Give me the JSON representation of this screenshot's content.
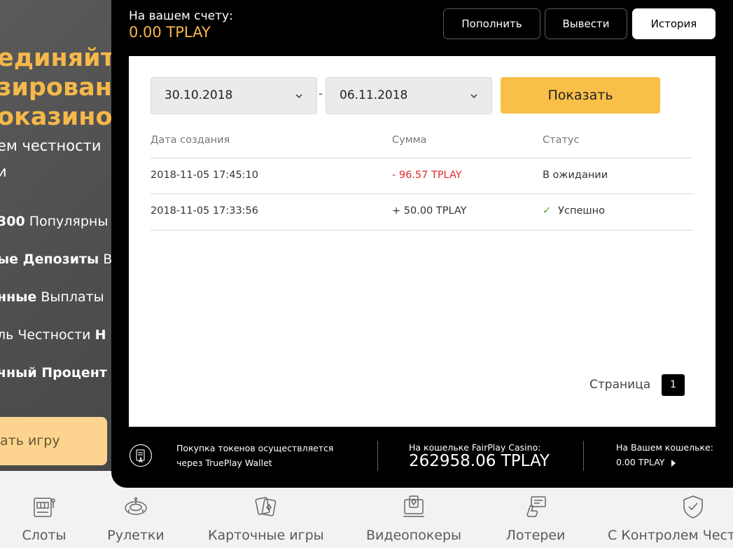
{
  "background": {
    "hero_lines": [
      "единяйт",
      "зирован",
      "оказино!"
    ],
    "sub_lines": [
      "ем честности",
      "и"
    ],
    "features": [
      {
        "bold": "300",
        "rest": " Популярны"
      },
      {
        "bold": "ые Депозиты",
        "rest": " В"
      },
      {
        "bold": "нные",
        "rest": " Выплаты"
      },
      {
        "bold": "",
        "rest": "ль Честности ",
        "bold2": "Н"
      },
      {
        "bold": "чный Процент",
        "rest": ""
      }
    ],
    "play_button": "ать игру",
    "categories": [
      {
        "label": "Слоты",
        "icon": "slot-machine-icon"
      },
      {
        "label": "Рулетки",
        "icon": "roulette-icon"
      },
      {
        "label": "Карточные игры",
        "icon": "cards-icon"
      },
      {
        "label": "Видеопокеры",
        "icon": "video-poker-icon"
      },
      {
        "label": "Лотереи",
        "icon": "lottery-icon"
      },
      {
        "label": "С Контролем Чест",
        "icon": "shield-check-icon"
      }
    ]
  },
  "modal": {
    "balance_label": "На вашем счету:",
    "balance_value": "0.00 TPLAY",
    "tabs": [
      {
        "label": "Пополнить",
        "active": false
      },
      {
        "label": "Вывести",
        "active": false
      },
      {
        "label": "История",
        "active": true
      }
    ],
    "filter": {
      "date_from": "30.10.2018",
      "separator": "-",
      "date_to": "06.11.2018",
      "show_button": "Показать"
    },
    "table": {
      "headers": [
        "Дата создания",
        "Сумма",
        "Статус"
      ],
      "rows": [
        {
          "date": "2018-11-05 17:45:10",
          "amount": "- 96.57 TPLAY",
          "status": "В ожидании",
          "success": false
        },
        {
          "date": "2018-11-05 17:33:56",
          "amount": "+ 50.00 TPLAY",
          "status": "Успешно",
          "success": true
        }
      ]
    },
    "pager": {
      "label": "Страница",
      "page": "1"
    },
    "footer": {
      "purchase_text_1": "Покупка токенов осуществляется",
      "purchase_text_2": "через TruePlay Wallet",
      "casino_wallet_label": "На кошельке FairPlay Casino:",
      "casino_wallet_value": "262958.06 TPLAY",
      "my_wallet_label": "На Вашем кошельке:",
      "my_wallet_value": "0.00 TPLAY"
    }
  },
  "colors": {
    "accent": "#f9bf49",
    "balance": "#f5b84a",
    "negative": "#e02a2a",
    "success": "#5aa02c"
  }
}
